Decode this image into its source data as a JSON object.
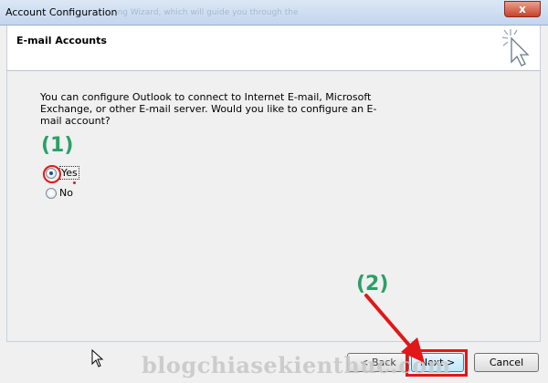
{
  "window": {
    "title": "Account Configuration",
    "ghost_title": "...ng Wizard, which will guide you through the",
    "close_glyph": "x"
  },
  "header": {
    "title": "E-mail Accounts"
  },
  "content": {
    "description": "You can configure Outlook to connect to Internet E-mail, Microsoft Exchange, or other E-mail server. Would you like to configure an E-mail account?",
    "step1_label": "(1)",
    "step2_label": "(2)",
    "options": {
      "yes": {
        "label": "Yes",
        "selected": true
      },
      "no": {
        "label": "No",
        "selected": false
      }
    }
  },
  "footer": {
    "back_label": "< Back",
    "next_label": "Next >",
    "cancel_label": "Cancel"
  },
  "watermark": "blogchiasekienthuc.com",
  "colors": {
    "annotation_red": "#e01818",
    "step_green": "#2aa068",
    "titlebar": "#c3d6ee"
  }
}
